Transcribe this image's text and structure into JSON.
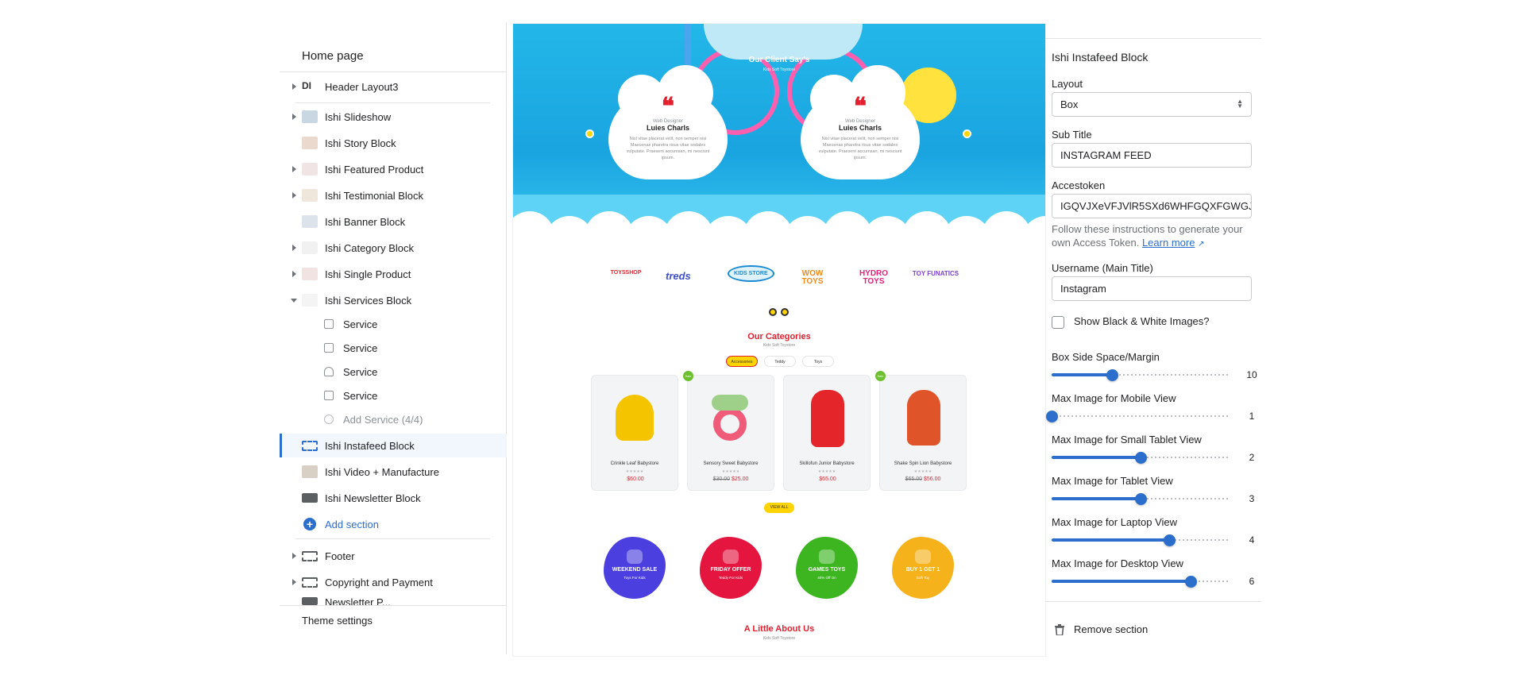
{
  "sidebar": {
    "page_title": "Home page",
    "header_section": "Header Layout3",
    "sections": [
      {
        "label": "Ishi Slideshow"
      },
      {
        "label": "Ishi Story Block"
      },
      {
        "label": "Ishi Featured Product"
      },
      {
        "label": "Ishi Testimonial Block"
      },
      {
        "label": "Ishi Banner Block"
      },
      {
        "label": "Ishi Category Block"
      },
      {
        "label": "Ishi Single Product"
      },
      {
        "label": "Ishi Services Block"
      }
    ],
    "services": [
      "Service",
      "Service",
      "Service",
      "Service"
    ],
    "add_service": "Add Service (4/4)",
    "sections_after": [
      {
        "label": "Ishi Instafeed Block"
      },
      {
        "label": "Ishi Video + Manufacture"
      },
      {
        "label": "Ishi Newsletter Block"
      }
    ],
    "add_section": "Add section",
    "footer_sections": [
      "Footer",
      "Copyright and Payment",
      "Newsletter P..."
    ],
    "theme_settings": "Theme settings"
  },
  "preview": {
    "testimonial_heading": "Our Client Say's",
    "testimonial_sub": "Kids Soft Toystore",
    "testimonials": [
      {
        "role": "Web Designer",
        "name": "Luies Charls",
        "text": "Nisl vitae placerat velit, non semper nisi Maecenas pharetra risus vitae sodales vulputate. Praesent accumsan, mi nesciunt ipsum."
      },
      {
        "role": "Web Designer",
        "name": "Luies Charls",
        "text": "Nisl vitae placerat velit, non semper nisi Maecenas pharetra risus vitae sodales vulputate. Praesent accumsan, mi nesciunt ipsum."
      }
    ],
    "brands": [
      "TOYSSHOP",
      "treds",
      "KIDS STORE",
      "WOW TOYS",
      "HYDRO TOYS",
      "TOY FUNATICS"
    ],
    "categories_title": "Our Categories",
    "categories_sub": "Kids Soft Toystore",
    "tabs": [
      "Accessories",
      "Teddy",
      "Toys"
    ],
    "products": [
      {
        "name": "Crinkle Leaf Babystore",
        "stars": "★★★★★",
        "old": "",
        "price": "$60.00",
        "badge": ""
      },
      {
        "name": "Sensory Sweet Babystore",
        "stars": "★★★★★",
        "old": "$30.00",
        "price": "$25.00",
        "badge": "Sale"
      },
      {
        "name": "Skillofun Junior Babystore",
        "stars": "★★★★★",
        "old": "",
        "price": "$65.00",
        "badge": ""
      },
      {
        "name": "Shake Spin Lion Babystore",
        "stars": "★★★★★",
        "old": "$65.00",
        "price": "$56.00",
        "badge": "Sale"
      }
    ],
    "view_all": "VIEW ALL",
    "offers": [
      {
        "title": "WEEKEND SALE",
        "sub": "Toys For Kids",
        "color": "#4b3fe0"
      },
      {
        "title": "FRIDAY OFFER",
        "sub": "Teddy For Kids",
        "color": "#e4163f"
      },
      {
        "title": "GAMES TOYS",
        "sub": "40% Off On",
        "color": "#3cb521"
      },
      {
        "title": "BUY 1 GET 1",
        "sub": "Soft Toy",
        "color": "#f5b21a"
      }
    ],
    "about_title": "A Little About Us",
    "about_sub": "Kids Soft Toystore"
  },
  "settings": {
    "panel_title": "Ishi Instafeed Block",
    "layout_label": "Layout",
    "layout_value": "Box",
    "subtitle_label": "Sub Title",
    "subtitle_value": "INSTAGRAM FEED",
    "token_label": "Accestoken",
    "token_value": "IGQVJXeVFJVlR5SXd6WHFGQXFGWGJ",
    "help_text": "Follow these instructions to generate your own Access Token.",
    "help_link": "Learn more",
    "username_label": "Username (Main Title)",
    "username_value": "Instagram",
    "bw_label": "Show Black & White Images?",
    "bw_checked": false,
    "sliders": [
      {
        "label": "Box Side Space/Margin",
        "value": "10",
        "fraction": 0.34
      },
      {
        "label": "Max Image for Mobile View",
        "value": "1",
        "fraction": 0.0
      },
      {
        "label": "Max Image for Small Tablet View",
        "value": "2",
        "fraction": 0.5
      },
      {
        "label": "Max Image for Tablet View",
        "value": "3",
        "fraction": 0.5
      },
      {
        "label": "Max Image for Laptop View",
        "value": "4",
        "fraction": 0.66
      },
      {
        "label": "Max Image for Desktop View",
        "value": "6",
        "fraction": 0.78
      }
    ],
    "remove_label": "Remove section",
    "accent_color": "#2c6ecb"
  }
}
